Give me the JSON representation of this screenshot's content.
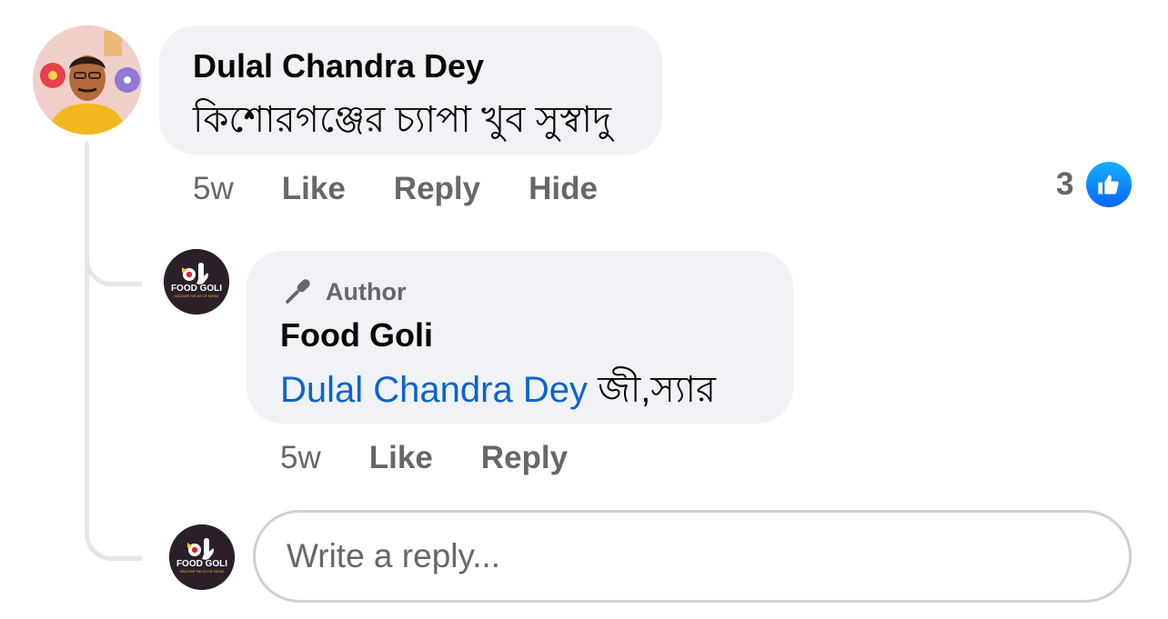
{
  "comment": {
    "author": "Dulal Chandra Dey",
    "text": "কিশোরগঞ্জের চ্যাপা খুব সুস্বাদু",
    "time": "5w",
    "actions": [
      "Like",
      "Reply",
      "Hide"
    ],
    "reaction_count": "3",
    "reaction_icon": "thumbs-up-icon"
  },
  "reply": {
    "badge_label": "Author",
    "badge_icon": "microphone-icon",
    "author": "Food Goli",
    "mention": "Dulal Chandra Dey",
    "text": " জী,স্যার",
    "time": "5w",
    "actions": [
      "Like",
      "Reply"
    ]
  },
  "composer": {
    "placeholder": "Write a reply..."
  },
  "brand": {
    "logo_text": "FOOD GOLI",
    "logo_tagline": "DISCOVER THE JOY OF EATING"
  },
  "colors": {
    "bubble": "#f0f2f5",
    "secondary_text": "#65676b",
    "mention": "#0a64d0",
    "like_blue": "#0866ff"
  }
}
